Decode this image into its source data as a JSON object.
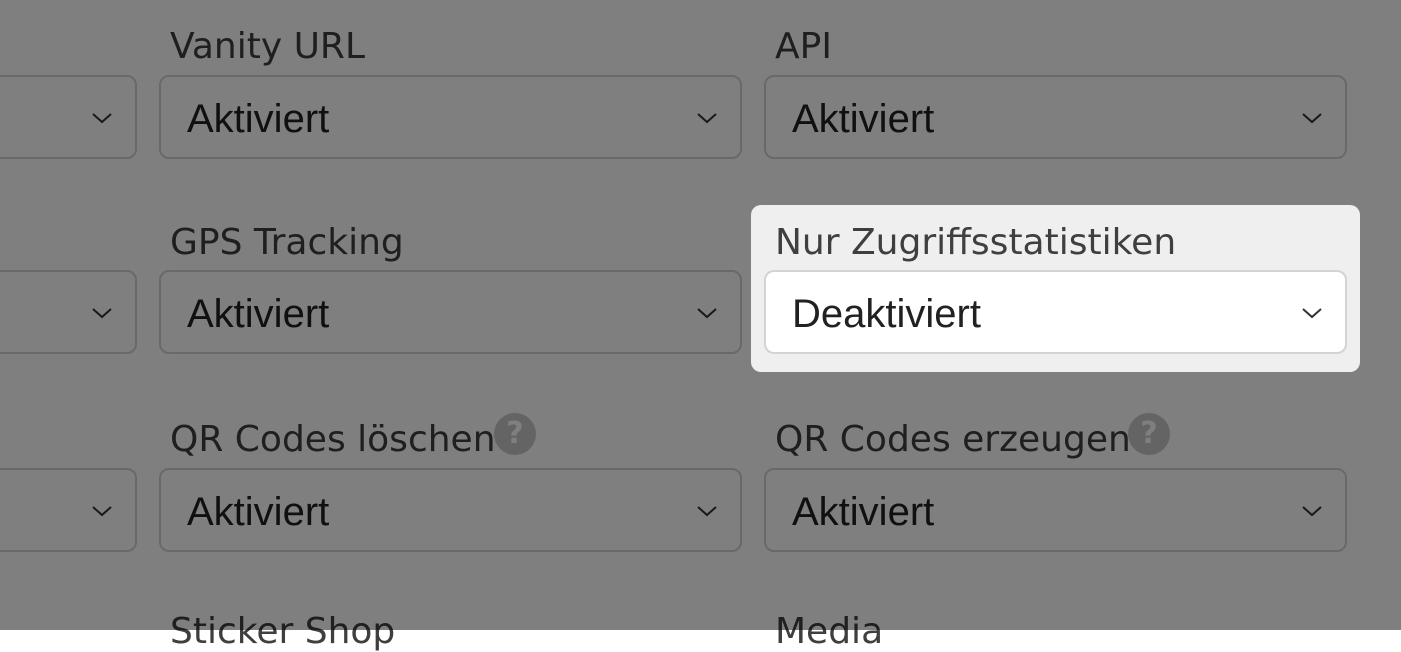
{
  "fields": {
    "col1_row1": {
      "value": ""
    },
    "col1_row2": {
      "value": ""
    },
    "col1_row3": {
      "value": ""
    },
    "vanity_url": {
      "label": "Vanity URL",
      "value": "Aktiviert"
    },
    "api": {
      "label": "API",
      "value": "Aktiviert"
    },
    "gps_tracking": {
      "label": "GPS Tracking",
      "value": "Aktiviert"
    },
    "nur_zugriffsstatistiken": {
      "label": "Nur Zugriffsstatistiken",
      "value": "Deaktiviert"
    },
    "qr_codes_loeschen": {
      "label": "QR Codes löschen",
      "value": "Aktiviert",
      "help": "?"
    },
    "qr_codes_erzeugen": {
      "label": "QR Codes erzeugen",
      "value": "Aktiviert",
      "help": "?"
    },
    "sticker_shop": {
      "label": "Sticker Shop"
    },
    "media": {
      "label": "Media"
    }
  },
  "overlay": {
    "dim_color": "#000000",
    "dim_opacity": 0.5,
    "spotlight_color": "#efefef"
  }
}
